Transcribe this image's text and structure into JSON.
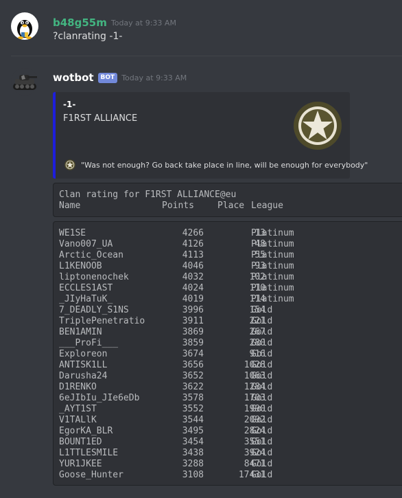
{
  "messages": [
    {
      "username": "b48g55m",
      "username_color": "#43b581",
      "timestamp": "Today at 9:33 AM",
      "text": "?clanrating -1-",
      "avatar_icon": "linux-penguin-icon"
    },
    {
      "username": "wotbot",
      "username_color": "#ffffff",
      "bot_tag": "BOT",
      "timestamp": "Today at 9:33 AM",
      "avatar_icon": "tank-icon",
      "embed": {
        "accent_color": "#1e1edc",
        "title": "-1-",
        "description": "F1RST ALLIANCE",
        "thumbnail_icon": "star-emblem-icon",
        "footer_icon": "star-emblem-icon",
        "footer_text": "\"Was not enough? Go back take place in line, will be enough for everybody\""
      },
      "code_header": {
        "title": "Clan rating for F1RST ALLIANCE@eu",
        "col_name": "Name",
        "col_points": "Points",
        "col_place": "Place",
        "col_league": "League"
      },
      "rows": [
        {
          "name": "WE1SE",
          "points": "4266",
          "place": "13",
          "league": "Platinum"
        },
        {
          "name": "Vano007_UA",
          "points": "4126",
          "place": "48",
          "league": "Platinum"
        },
        {
          "name": "Arctic_Ocean",
          "points": "4113",
          "place": "55",
          "league": "Platinum"
        },
        {
          "name": "L1KENOOB",
          "points": "4046",
          "place": "93",
          "league": "Platinum"
        },
        {
          "name": "liptonenochek",
          "points": "4032",
          "place": "102",
          "league": "Platinum"
        },
        {
          "name": "ECCLES1AST",
          "points": "4024",
          "place": "110",
          "league": "Platinum"
        },
        {
          "name": "_JIyHaTuK_",
          "points": "4019",
          "place": "114",
          "league": "Platinum"
        },
        {
          "name": "7_DEADLY_S1NS",
          "points": "3996",
          "place": "154",
          "league": "Gold"
        },
        {
          "name": "TriplePenetratio",
          "points": "3911",
          "place": "221",
          "league": "Gold"
        },
        {
          "name": "BEN1AMIN",
          "points": "3869",
          "place": "267",
          "league": "Gold"
        },
        {
          "name": "___ProFi___",
          "points": "3859",
          "place": "280",
          "league": "Gold"
        },
        {
          "name": "Exploreon",
          "points": "3674",
          "place": "916",
          "league": "Gold"
        },
        {
          "name": "ANTISK1LL",
          "points": "3656",
          "place": "1028",
          "league": "Gold"
        },
        {
          "name": "Darusha24",
          "points": "3652",
          "place": "1063",
          "league": "Gold"
        },
        {
          "name": "D1RENKO",
          "points": "3622",
          "place": "1284",
          "league": "Gold"
        },
        {
          "name": "6eJIbIu_JIe6eDb",
          "points": "3578",
          "place": "1703",
          "league": "Gold"
        },
        {
          "name": "_AYT1ST",
          "points": "3552",
          "place": "1990",
          "league": "Gold"
        },
        {
          "name": "V1TALlK",
          "points": "3544",
          "place": "2092",
          "league": "Gold"
        },
        {
          "name": "EgorKA_BLR",
          "points": "3495",
          "place": "2824",
          "league": "Gold"
        },
        {
          "name": "BOUNT1ED",
          "points": "3454",
          "place": "3551",
          "league": "Gold"
        },
        {
          "name": "L1TTLESMILE",
          "points": "3438",
          "place": "3924",
          "league": "Gold"
        },
        {
          "name": "YUR1JKEE",
          "points": "3288",
          "place": "8471",
          "league": "Gold"
        },
        {
          "name": "Goose_Hunter",
          "points": "3108",
          "place": "17431",
          "league": "Gold"
        }
      ]
    }
  ]
}
